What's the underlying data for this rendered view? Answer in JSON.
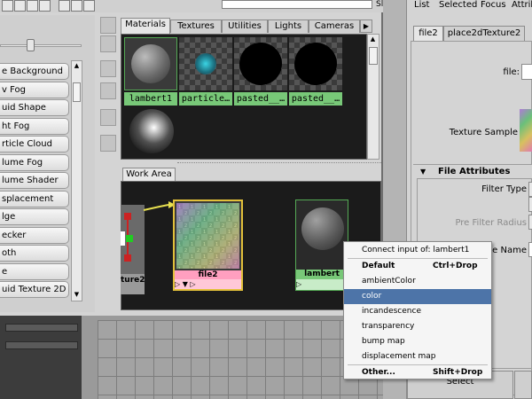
{
  "toolbar": {
    "right_label": "Sl"
  },
  "create_list": {
    "items": [
      "e Background",
      "v Fog",
      "uid Shape",
      "ht Fog",
      "rticle Cloud",
      "lume Fog",
      "lume Shader",
      "splacement",
      "lge",
      "ecker",
      "oth",
      "e",
      "uid Texture 2D"
    ]
  },
  "tabs": [
    "Materials",
    "Textures",
    "Utilities",
    "Lights",
    "Cameras"
  ],
  "swatches": [
    {
      "label": "lambert1"
    },
    {
      "label": "particle…"
    },
    {
      "label": "pasted__…"
    },
    {
      "label": "pasted__…"
    },
    {
      "label": ""
    }
  ],
  "work_area": {
    "tab_label": "Work Area",
    "left_node_label": "ture2",
    "file_node": {
      "label": "file2",
      "ports": "▷    ▼    ▷"
    },
    "lambert_node": {
      "label": "lambert",
      "ports": "▷"
    }
  },
  "context_menu": {
    "header": "Connect input of: lambert1",
    "items": [
      {
        "label": "Default",
        "shortcut": "Ctrl+Drop",
        "bold": true
      },
      {
        "label": "ambientColor",
        "shortcut": ""
      },
      {
        "label": "color",
        "shortcut": "",
        "highlighted": true
      },
      {
        "label": "incandescence",
        "shortcut": ""
      },
      {
        "label": "transparency",
        "shortcut": ""
      },
      {
        "label": "bump map",
        "shortcut": ""
      },
      {
        "label": "displacement map",
        "shortcut": ""
      },
      {
        "label": "Other...",
        "shortcut": "Shift+Drop",
        "bold": true
      }
    ]
  },
  "attribute_editor": {
    "menu": [
      "List",
      "Selected",
      "Focus",
      "Attribu"
    ],
    "tabs": [
      "file2",
      "place2dTexture2"
    ],
    "file_label": "file:",
    "texture_sample_label": "Texture Sample",
    "section_title": "File Attributes",
    "filter_type_label": "Filter Type",
    "pre_filter_radius_label": "Pre Filter Radius",
    "image_name_label": "age Name",
    "select_button": "Select"
  },
  "colors": {
    "menu_highlight": "#4d74a8",
    "material_label": "#78c878",
    "file_label": "#ff9fbf",
    "selection_border": "#e2c03a"
  }
}
